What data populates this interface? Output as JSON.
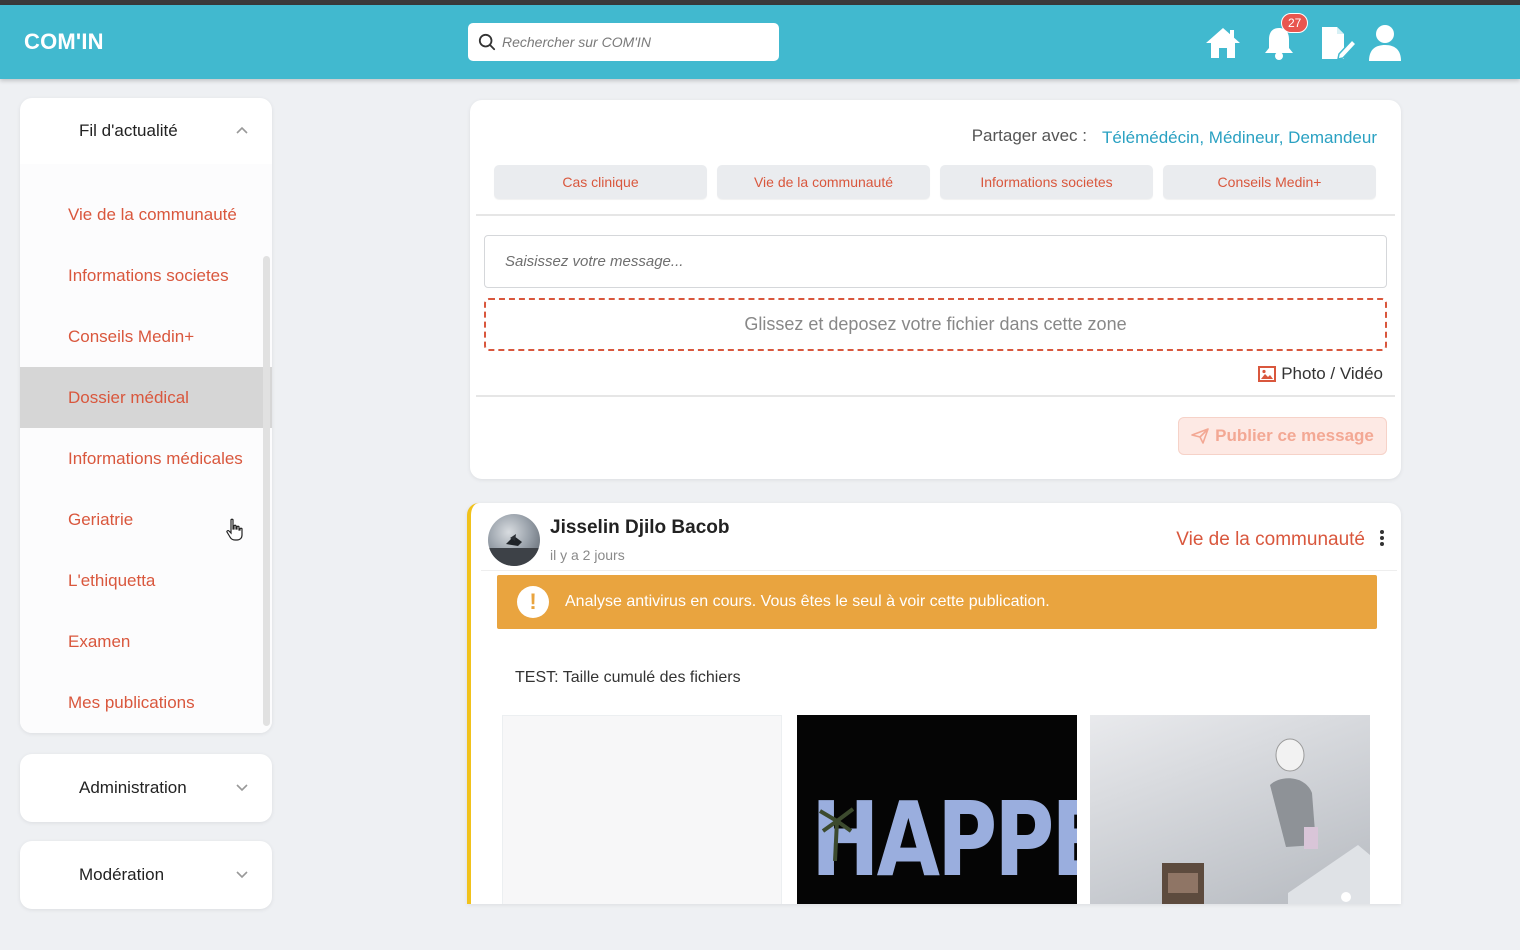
{
  "app": {
    "brand": "COM'IN"
  },
  "search": {
    "placeholder": "Rechercher sur COM'IN"
  },
  "nav": {
    "icons": [
      "home-icon",
      "bell-icon",
      "file-edit-icon",
      "user-icon"
    ],
    "notifications_count": "27"
  },
  "sidebar": {
    "header": "Fil d'actualité",
    "items": [
      {
        "label": "Vie de la communauté"
      },
      {
        "label": "Informations societes"
      },
      {
        "label": "Conseils Medin+"
      },
      {
        "label": "Dossier médical",
        "active": true
      },
      {
        "label": "Informations médicales"
      },
      {
        "label": "Geriatrie"
      },
      {
        "label": "L'ethiquetta"
      },
      {
        "label": "Examen"
      },
      {
        "label": "Mes publications"
      }
    ],
    "sections": [
      {
        "label": "Administration"
      },
      {
        "label": "Modération"
      }
    ]
  },
  "composer": {
    "share_label": "Partager avec :",
    "share_with": "Télémédécin, Médineur, Demandeur",
    "categories": [
      "Cas clinique",
      "Vie de la communauté",
      "Informations societes",
      "Conseils Medin+"
    ],
    "message_placeholder": "Saisissez votre message...",
    "dropzone_text": "Glissez et deposez votre fichier dans cette zone",
    "photo_video": "Photo / Vidéo",
    "publish_label": "Publier ce message"
  },
  "post": {
    "author": "Jisselin Djilo Bacob",
    "time": "il y a 2 jours",
    "category": "Vie de la communauté",
    "alert": "Analyse antivirus en cours. Vous êtes le seul à voir cette publication.",
    "text": "TEST: Taille cumulé des fichiers",
    "media_caption": "HAPPE"
  },
  "colors": {
    "primary": "#41b9cf",
    "accent": "#d9573d",
    "link": "#2aa1c2",
    "warning": "#e9a43f",
    "post_border": "#f1c21b"
  }
}
